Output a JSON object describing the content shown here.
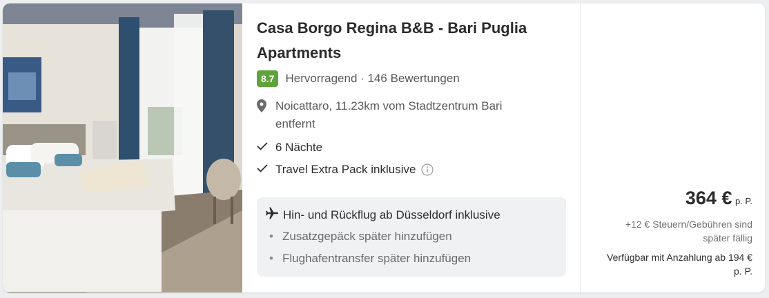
{
  "hotel": {
    "name": "Casa Borgo Regina B&B - Bari Puglia Apartments",
    "score": "8.7",
    "rating_text": "Hervorragend · 146 Bewertungen",
    "location": "Noicattaro, 11.23km vom Stadtzentrum Bari entfernt",
    "features": [
      "6 Nächte",
      "Travel Extra Pack inklusive"
    ]
  },
  "flight": {
    "main": "Hin- und Rückflug ab Düsseldorf inklusive",
    "sub_items": [
      "Zusatzgepäck später hinzufügen",
      "Flughafentransfer später hinzufügen"
    ]
  },
  "price": {
    "amount": "364 €",
    "unit": "p. P.",
    "tax_note": "+12 € Steuern/Gebühren sind später fällig",
    "deposit_note": "Verfügbar mit Anzahlung ab 194 € p. P."
  },
  "colors": {
    "score_badge": "#5fa33c",
    "card": "#ffffff",
    "flight_box": "#f0f1f3"
  },
  "icons": {
    "location": "map-pin-icon",
    "check": "checkmark-icon",
    "info": "info-circle-icon",
    "flight": "airplane-icon",
    "bullet": "bullet-dot"
  }
}
